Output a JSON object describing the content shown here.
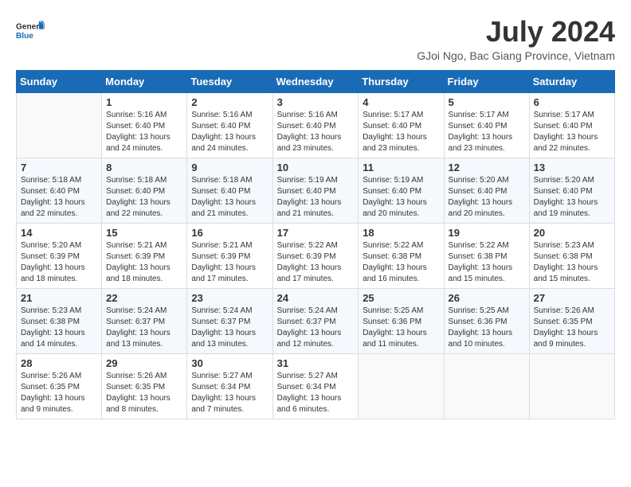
{
  "logo": {
    "line1": "General",
    "line2": "Blue"
  },
  "title": "July 2024",
  "location": "GJoi Ngo, Bac Giang Province, Vietnam",
  "weekdays": [
    "Sunday",
    "Monday",
    "Tuesday",
    "Wednesday",
    "Thursday",
    "Friday",
    "Saturday"
  ],
  "weeks": [
    [
      {
        "day": "",
        "info": ""
      },
      {
        "day": "1",
        "info": "Sunrise: 5:16 AM\nSunset: 6:40 PM\nDaylight: 13 hours and 24 minutes."
      },
      {
        "day": "2",
        "info": "Sunrise: 5:16 AM\nSunset: 6:40 PM\nDaylight: 13 hours and 24 minutes."
      },
      {
        "day": "3",
        "info": "Sunrise: 5:16 AM\nSunset: 6:40 PM\nDaylight: 13 hours and 23 minutes."
      },
      {
        "day": "4",
        "info": "Sunrise: 5:17 AM\nSunset: 6:40 PM\nDaylight: 13 hours and 23 minutes."
      },
      {
        "day": "5",
        "info": "Sunrise: 5:17 AM\nSunset: 6:40 PM\nDaylight: 13 hours and 23 minutes."
      },
      {
        "day": "6",
        "info": "Sunrise: 5:17 AM\nSunset: 6:40 PM\nDaylight: 13 hours and 22 minutes."
      }
    ],
    [
      {
        "day": "7",
        "info": "Sunrise: 5:18 AM\nSunset: 6:40 PM\nDaylight: 13 hours and 22 minutes."
      },
      {
        "day": "8",
        "info": "Sunrise: 5:18 AM\nSunset: 6:40 PM\nDaylight: 13 hours and 22 minutes."
      },
      {
        "day": "9",
        "info": "Sunrise: 5:18 AM\nSunset: 6:40 PM\nDaylight: 13 hours and 21 minutes."
      },
      {
        "day": "10",
        "info": "Sunrise: 5:19 AM\nSunset: 6:40 PM\nDaylight: 13 hours and 21 minutes."
      },
      {
        "day": "11",
        "info": "Sunrise: 5:19 AM\nSunset: 6:40 PM\nDaylight: 13 hours and 20 minutes."
      },
      {
        "day": "12",
        "info": "Sunrise: 5:20 AM\nSunset: 6:40 PM\nDaylight: 13 hours and 20 minutes."
      },
      {
        "day": "13",
        "info": "Sunrise: 5:20 AM\nSunset: 6:40 PM\nDaylight: 13 hours and 19 minutes."
      }
    ],
    [
      {
        "day": "14",
        "info": "Sunrise: 5:20 AM\nSunset: 6:39 PM\nDaylight: 13 hours and 18 minutes."
      },
      {
        "day": "15",
        "info": "Sunrise: 5:21 AM\nSunset: 6:39 PM\nDaylight: 13 hours and 18 minutes."
      },
      {
        "day": "16",
        "info": "Sunrise: 5:21 AM\nSunset: 6:39 PM\nDaylight: 13 hours and 17 minutes."
      },
      {
        "day": "17",
        "info": "Sunrise: 5:22 AM\nSunset: 6:39 PM\nDaylight: 13 hours and 17 minutes."
      },
      {
        "day": "18",
        "info": "Sunrise: 5:22 AM\nSunset: 6:38 PM\nDaylight: 13 hours and 16 minutes."
      },
      {
        "day": "19",
        "info": "Sunrise: 5:22 AM\nSunset: 6:38 PM\nDaylight: 13 hours and 15 minutes."
      },
      {
        "day": "20",
        "info": "Sunrise: 5:23 AM\nSunset: 6:38 PM\nDaylight: 13 hours and 15 minutes."
      }
    ],
    [
      {
        "day": "21",
        "info": "Sunrise: 5:23 AM\nSunset: 6:38 PM\nDaylight: 13 hours and 14 minutes."
      },
      {
        "day": "22",
        "info": "Sunrise: 5:24 AM\nSunset: 6:37 PM\nDaylight: 13 hours and 13 minutes."
      },
      {
        "day": "23",
        "info": "Sunrise: 5:24 AM\nSunset: 6:37 PM\nDaylight: 13 hours and 13 minutes."
      },
      {
        "day": "24",
        "info": "Sunrise: 5:24 AM\nSunset: 6:37 PM\nDaylight: 13 hours and 12 minutes."
      },
      {
        "day": "25",
        "info": "Sunrise: 5:25 AM\nSunset: 6:36 PM\nDaylight: 13 hours and 11 minutes."
      },
      {
        "day": "26",
        "info": "Sunrise: 5:25 AM\nSunset: 6:36 PM\nDaylight: 13 hours and 10 minutes."
      },
      {
        "day": "27",
        "info": "Sunrise: 5:26 AM\nSunset: 6:35 PM\nDaylight: 13 hours and 9 minutes."
      }
    ],
    [
      {
        "day": "28",
        "info": "Sunrise: 5:26 AM\nSunset: 6:35 PM\nDaylight: 13 hours and 9 minutes."
      },
      {
        "day": "29",
        "info": "Sunrise: 5:26 AM\nSunset: 6:35 PM\nDaylight: 13 hours and 8 minutes."
      },
      {
        "day": "30",
        "info": "Sunrise: 5:27 AM\nSunset: 6:34 PM\nDaylight: 13 hours and 7 minutes."
      },
      {
        "day": "31",
        "info": "Sunrise: 5:27 AM\nSunset: 6:34 PM\nDaylight: 13 hours and 6 minutes."
      },
      {
        "day": "",
        "info": ""
      },
      {
        "day": "",
        "info": ""
      },
      {
        "day": "",
        "info": ""
      }
    ]
  ]
}
